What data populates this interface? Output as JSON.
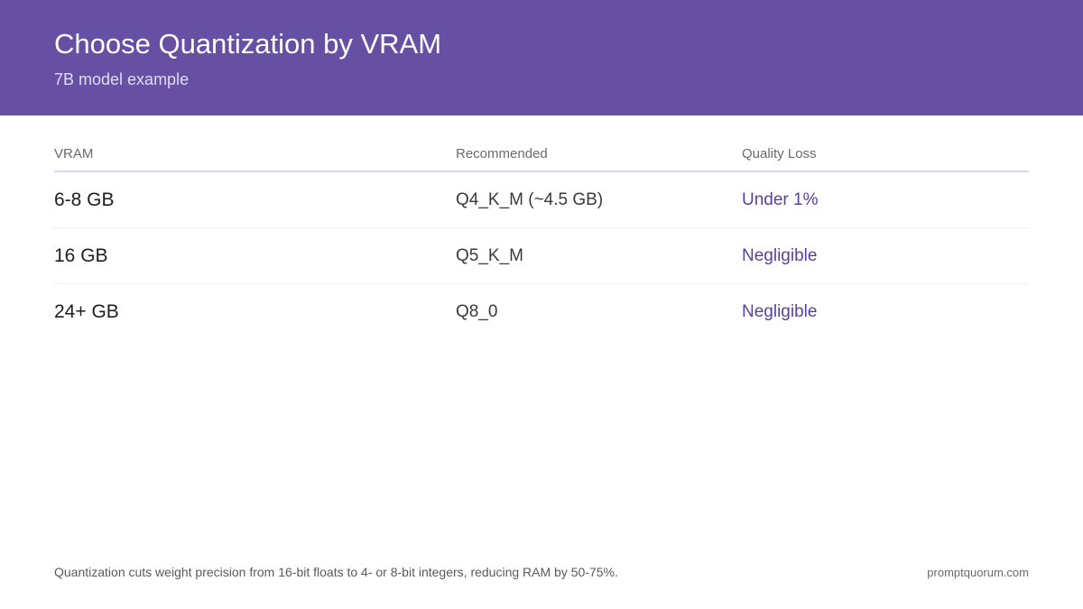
{
  "header": {
    "title": "Choose Quantization by VRAM",
    "subtitle": "7B model example"
  },
  "table": {
    "columns": [
      "VRAM",
      "Recommended",
      "Quality Loss"
    ],
    "rows": [
      {
        "vram": "6-8 GB",
        "recommended": "Q4_K_M (~4.5 GB)",
        "quality_loss": "Under 1%"
      },
      {
        "vram": "16 GB",
        "recommended": "Q5_K_M",
        "quality_loss": "Negligible"
      },
      {
        "vram": "24+ GB",
        "recommended": "Q8_0",
        "quality_loss": "Negligible"
      }
    ]
  },
  "footer": {
    "note": "Quantization cuts weight precision from 16-bit floats to 4- or 8-bit integers, reducing RAM by 50-75%.",
    "site": "promptquorum.com"
  },
  "colors": {
    "header_bg": "#674fa3",
    "accent_text": "#5b3fa0",
    "header_rule": "#ddd6f2"
  }
}
